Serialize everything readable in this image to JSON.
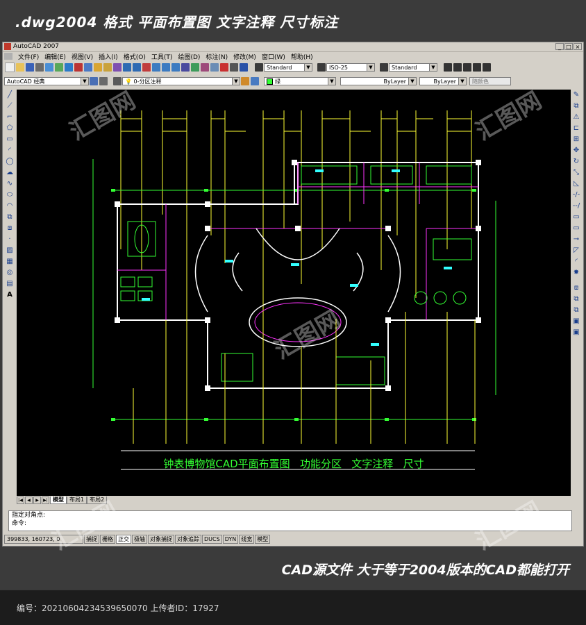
{
  "banner_top": {
    "text": ".dwg2004 格式  平面布置图 文字注释 尺寸标注"
  },
  "window": {
    "title": "AutoCAD 2007"
  },
  "menu": [
    "文件(F)",
    "编辑(E)",
    "视图(V)",
    "插入(I)",
    "格式(O)",
    "工具(T)",
    "绘图(D)",
    "标注(N)",
    "修改(M)",
    "窗口(W)",
    "帮助(H)"
  ],
  "toolbar": {
    "text_style": "Standard",
    "dim_style": "ISO-25",
    "table_style": "Standard",
    "workspace": "AutoCAD 经典",
    "layer": "0-分区注释",
    "color": "绿",
    "linetype": "ByLayer",
    "lineweight": "ByLayer",
    "plotstyle": "随颜色"
  },
  "drawing": {
    "title": "钟表博物馆CAD平面布置图   功能分区   文字注释   尺寸",
    "colors": {
      "background": "#000000",
      "wall": "#ffffff",
      "furniture": "#33ff33",
      "magenta": "#ff33ff",
      "yellow": "#ffff33",
      "cyan": "#33ffff"
    }
  },
  "layout_tabs": [
    "模型",
    "布局1",
    "布局2"
  ],
  "command": {
    "line1": "指定对角点:",
    "line2": "命令:"
  },
  "status": {
    "coords": "399833, 160723, 0",
    "buttons": [
      "捕捉",
      "栅格",
      "正交",
      "极轴",
      "对象捕捉",
      "对象追踪",
      "DUCS",
      "DYN",
      "线宽",
      "模型"
    ]
  },
  "banner_bottom": {
    "text": "CAD源文件  大于等于2004版本的CAD都能打开"
  },
  "footer": {
    "text": "编号：20210604234539650070 上传者ID：17927"
  },
  "watermark": {
    "text": "汇图网"
  }
}
